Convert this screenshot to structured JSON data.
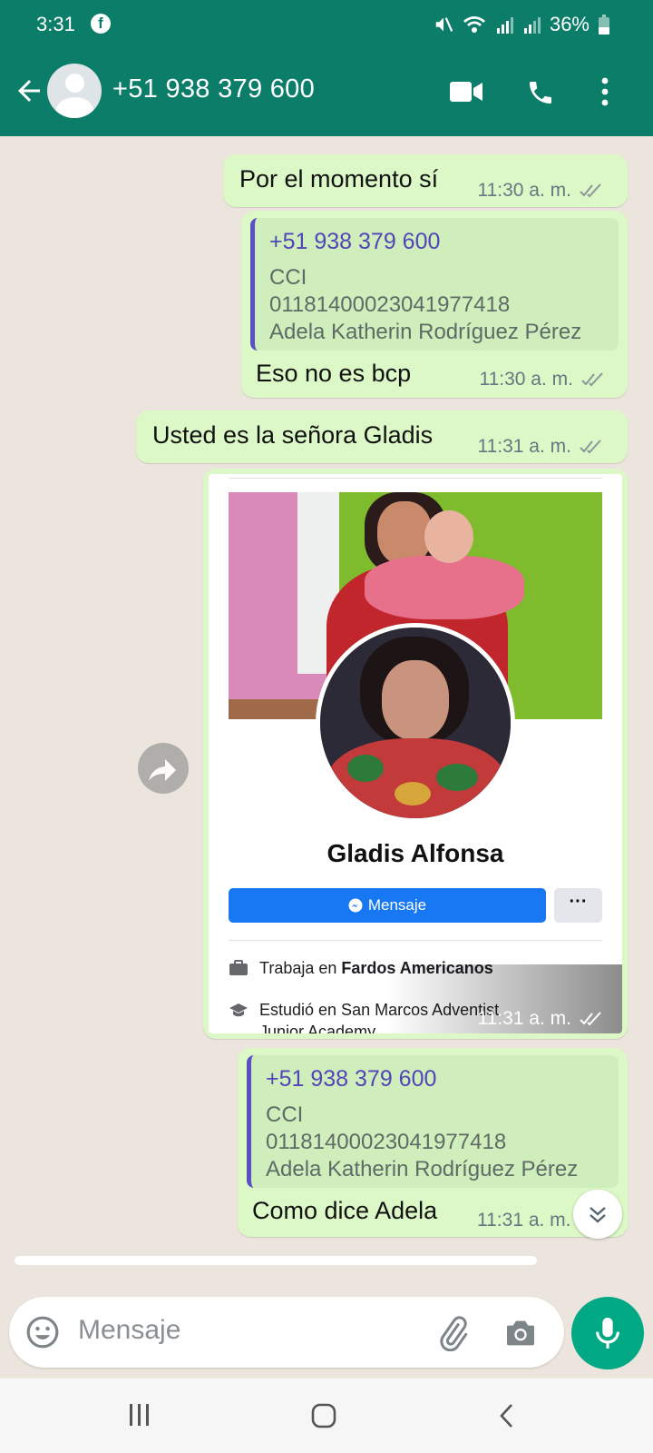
{
  "status_bar": {
    "time": "3:31",
    "battery": "36%",
    "icons": [
      "facebook-icon",
      "mute-icon",
      "wifi-icon",
      "signal-icon",
      "signal-icon",
      "battery-icon"
    ]
  },
  "header": {
    "contact": "+51 938 379 600",
    "icons": [
      "back-arrow-icon",
      "avatar",
      "video-call-icon",
      "phone-icon",
      "more-vert-icon"
    ]
  },
  "messages": [
    {
      "type": "text",
      "text": "Por el momento sí",
      "time": "11:30 a. m."
    },
    {
      "type": "reply",
      "quote": {
        "name": "+51 938 379 600",
        "lines": [
          "CCI",
          "01181400023041977418",
          "Adela Katherin Rodríguez Pérez"
        ]
      },
      "text": "Eso no es bcp",
      "time": "11:30 a. m."
    },
    {
      "type": "text",
      "text": "Usted es la señora Gladis",
      "time": "11:31 a. m."
    },
    {
      "type": "image",
      "time": "11:31 a. m.",
      "card": {
        "name": "Gladis Alfonsa",
        "message_button": "Mensaje",
        "more_button": "···",
        "work_prefix": "Trabaja en ",
        "work_place": "Fardos Americanos",
        "study_line1": "Estudió en San Marcos Adventist",
        "study_line2": "Junior Academy"
      }
    },
    {
      "type": "reply",
      "quote": {
        "name": "+51 938 379 600",
        "lines": [
          "CCI",
          "01181400023041977418",
          "Adela Katherin Rodríguez Pérez"
        ]
      },
      "text": "Como dice Adela",
      "time": "11:31 a. m."
    }
  ],
  "input": {
    "placeholder": "Mensaje"
  },
  "colors": {
    "header": "#0b7d68",
    "outgoing_bubble": "#dcf8c6",
    "chat_background": "#ece5dd",
    "mic_button": "#00a884",
    "quote_bar": "#5b4fc6",
    "fb_blue": "#1877f2"
  }
}
